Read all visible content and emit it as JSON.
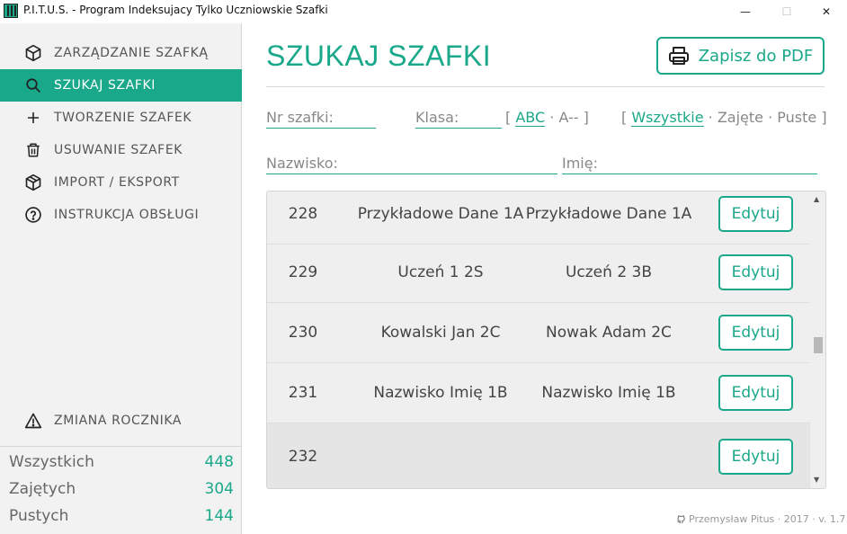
{
  "window": {
    "title": "P.I.T.U.S. - Program Indeksujacy Tylko Uczniowskie Szafki",
    "minimize": "—",
    "maximize": "☐",
    "close": "✕"
  },
  "sidebar": {
    "items": [
      {
        "label": "ZARZĄDZANIE SZAFKĄ",
        "icon": "box-icon"
      },
      {
        "label": "SZUKAJ SZAFKI",
        "icon": "search-icon",
        "active": true
      },
      {
        "label": "TWORZENIE SZAFEK",
        "icon": "plus-icon"
      },
      {
        "label": "USUWANIE SZAFEK",
        "icon": "trash-icon"
      },
      {
        "label": "IMPORT / EKSPORT",
        "icon": "package-icon"
      },
      {
        "label": "INSTRUKCJA OBSŁUGI",
        "icon": "help-circle-icon"
      }
    ],
    "year_change": {
      "label": "ZMIANA ROCZNIKA",
      "icon": "warning-icon"
    },
    "stats": [
      {
        "label": "Wszystkich",
        "value": "448"
      },
      {
        "label": "Zajętych",
        "value": "304"
      },
      {
        "label": "Pustych",
        "value": "144"
      }
    ]
  },
  "main": {
    "title": "SZUKAJ SZAFKI",
    "pdf_button": "Zapisz do PDF",
    "filters": {
      "locker_nr_placeholder": "Nr szafki:",
      "class_placeholder": "Klasa:",
      "sort_open": "[",
      "sort_selected": "ABC",
      "sort_sep": "·",
      "sort_other": "A--",
      "sort_close": "]",
      "status_open": "[",
      "status_selected": "Wszystkie",
      "status_sep1": "·",
      "status_taken": "Zajęte",
      "status_sep2": "·",
      "status_empty": "Puste",
      "status_close": "]",
      "surname_placeholder": "Nazwisko:",
      "name_placeholder": "Imię:"
    },
    "rows": [
      {
        "nr": "228",
        "student1": "Przykładowe Dane 1A",
        "student2": "Przykładowe Dane 1A",
        "action": "Edytuj"
      },
      {
        "nr": "229",
        "student1": "Uczeń 1 2S",
        "student2": "Uczeń 2 3B",
        "action": "Edytuj"
      },
      {
        "nr": "230",
        "student1": "Kowalski Jan 2C",
        "student2": "Nowak Adam 2C",
        "action": "Edytuj"
      },
      {
        "nr": "231",
        "student1": "Nazwisko Imię 1B",
        "student2": "Nazwisko Imię 1B",
        "action": "Edytuj"
      },
      {
        "nr": "232",
        "student1": "",
        "student2": "",
        "action": "Edytuj"
      }
    ]
  },
  "footer": {
    "text": "Przemysław Pitus · 2017 · v. 1.7",
    "icon": "github-icon"
  },
  "colors": {
    "accent": "#1aa88a"
  }
}
